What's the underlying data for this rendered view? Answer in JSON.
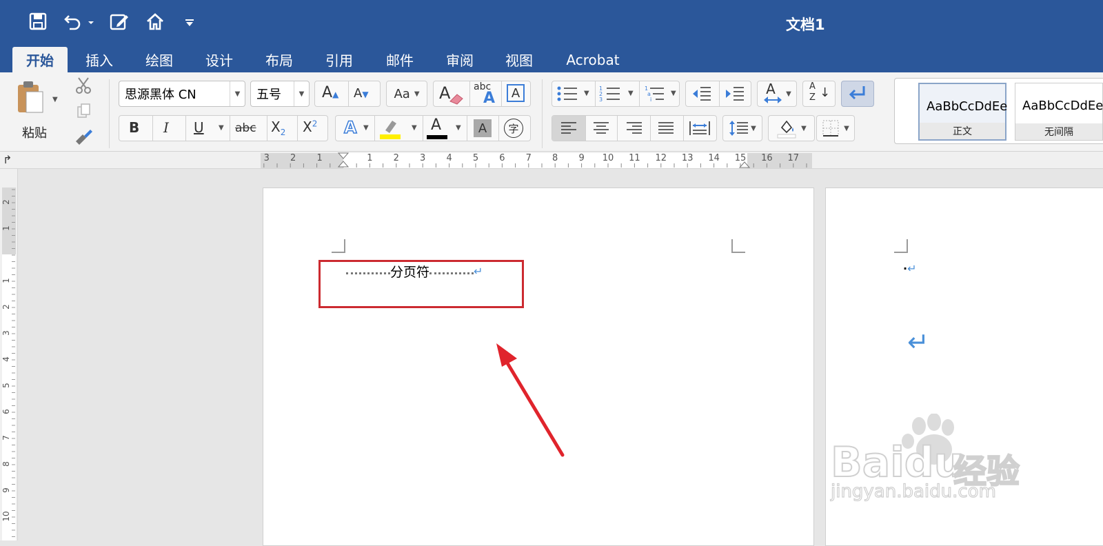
{
  "window": {
    "title": "文档1"
  },
  "quick_access": {
    "save_icon": "save-icon",
    "undo_icon": "undo-icon",
    "edit_icon": "edit-icon",
    "home_icon": "home-icon",
    "customize_icon": "customize-icon"
  },
  "tabs": [
    {
      "label": "开始",
      "active": true
    },
    {
      "label": "插入"
    },
    {
      "label": "绘图"
    },
    {
      "label": "设计"
    },
    {
      "label": "布局"
    },
    {
      "label": "引用"
    },
    {
      "label": "邮件"
    },
    {
      "label": "审阅"
    },
    {
      "label": "视图"
    },
    {
      "label": "Acrobat"
    }
  ],
  "clipboard": {
    "paste_label": "粘贴"
  },
  "font": {
    "family": "思源黑体 CN",
    "size": "五号",
    "grow_label": "A",
    "shrink_label": "A",
    "bold": "B",
    "italic": "I",
    "underline": "U",
    "strike": "abc",
    "subscript": "X",
    "subscript_mark": "2",
    "superscript": "X",
    "superscript_mark": "2",
    "effects": "A",
    "highlight_color": "#ffef00",
    "font_color_letter": "A",
    "font_color": "#000000",
    "shading_letter": "A",
    "enclose_char": "字",
    "change_case": "Aa",
    "clear_format_letter": "A",
    "phonetic_top": "abc",
    "phonetic_bottom": "A",
    "char_border": "A"
  },
  "paragraph": {
    "sort_top": "A",
    "sort_bottom": "Z",
    "asian_layout": "A"
  },
  "styles": [
    {
      "sample": "AaBbCcDdEe",
      "name": "正文",
      "selected": true
    },
    {
      "sample": "AaBbCcDdEe",
      "name": "无间隔"
    }
  ],
  "ruler": {
    "left_numbers": [
      "3",
      "2",
      "1"
    ],
    "right_numbers": [
      "1",
      "2",
      "3",
      "4",
      "5",
      "6",
      "7",
      "8",
      "9",
      "10",
      "11",
      "12",
      "13",
      "14",
      "15",
      "16",
      "17"
    ],
    "vertical_numbers": [
      "2",
      "1",
      "1",
      "2",
      "3",
      "4",
      "5",
      "6",
      "7",
      "8",
      "9",
      "10"
    ]
  },
  "document": {
    "page_break_text": "分页符",
    "para_mark": "↵"
  },
  "colors": {
    "title_bar": "#2b579a",
    "ribbon": "#f3f3f3",
    "annotation_red": "#cc2a30",
    "para_mark_blue": "#4a90d9"
  },
  "watermark": {
    "brand": "Baidu",
    "brand_cn": "经验",
    "url": "jingyan.baidu.com"
  }
}
